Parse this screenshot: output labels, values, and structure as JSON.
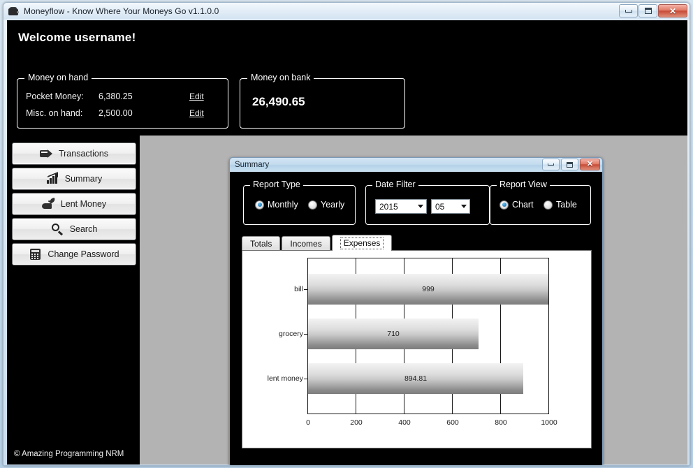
{
  "window": {
    "title": "Moneyflow - Know Where Your Moneys Go v1.1.0.0",
    "icon": "wallet-icon",
    "minimize": "–",
    "maximize": "□",
    "close": "✕"
  },
  "header": {
    "welcome": "Welcome username!"
  },
  "money_on_hand": {
    "title": "Money on hand",
    "rows": [
      {
        "label": "Pocket Money:",
        "value": "6,380.25",
        "action": "Edit"
      },
      {
        "label": "Misc. on hand:",
        "value": "2,500.00",
        "action": "Edit"
      }
    ]
  },
  "money_on_bank": {
    "title": "Money on bank",
    "amount": "26,490.65"
  },
  "sidebar": {
    "items": [
      {
        "label": "Transactions",
        "icon": "transactions-icon"
      },
      {
        "label": "Summary",
        "icon": "bar-chart-icon"
      },
      {
        "label": "Lent Money",
        "icon": "hand-money-icon"
      },
      {
        "label": "Search",
        "icon": "magnifier-icon"
      },
      {
        "label": "Change Password",
        "icon": "calculator-icon"
      }
    ]
  },
  "footer": {
    "copyright": "© Amazing Programming NRM"
  },
  "summary_window": {
    "title": "Summary",
    "minimize": "–",
    "maximize": "□",
    "close": "✕",
    "report_type": {
      "title": "Report Type",
      "options": [
        "Monthly",
        "Yearly"
      ],
      "selected": "Monthly"
    },
    "date_filter": {
      "title": "Date Filter",
      "year": "2015",
      "month": "05"
    },
    "report_view": {
      "title": "Report View",
      "options": [
        "Chart",
        "Table"
      ],
      "selected": "Chart"
    },
    "tabs": [
      {
        "label": "Totals",
        "active": false
      },
      {
        "label": "Incomes",
        "active": false
      },
      {
        "label": "Expenses",
        "active": true
      }
    ]
  },
  "chart_data": {
    "type": "bar",
    "orientation": "horizontal",
    "title": "",
    "xlabel": "",
    "ylabel": "",
    "categories": [
      "bill",
      "grocery",
      "lent money"
    ],
    "values": [
      999,
      710,
      894.81
    ],
    "labels": [
      "999",
      "710",
      "894.81"
    ],
    "xlim": [
      0,
      1000
    ],
    "xticks": [
      0,
      200,
      400,
      600,
      800,
      1000
    ],
    "xtick_labels": [
      "0",
      "200",
      "400",
      "600",
      "800",
      "1000"
    ],
    "grid": "vertical",
    "legend": "none"
  }
}
